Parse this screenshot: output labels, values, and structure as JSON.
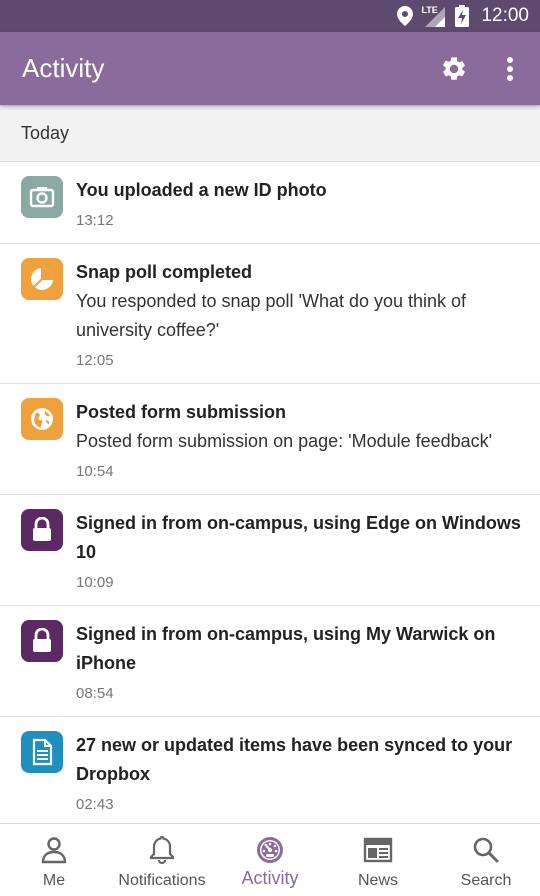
{
  "status_bar": {
    "network": "LTE",
    "time": "12:00"
  },
  "app_bar": {
    "title": "Activity"
  },
  "section": {
    "label": "Today"
  },
  "activities": [
    {
      "title": "You uploaded a new ID photo",
      "description": "",
      "time": "13:12",
      "icon": "camera-icon",
      "color": "#8aa9a3"
    },
    {
      "title": "Snap poll completed",
      "description": "You responded to snap poll 'What do you think of university coffee?'",
      "time": "12:05",
      "icon": "pie-chart-icon",
      "color": "#f0a03c"
    },
    {
      "title": "Posted form submission",
      "description": "Posted form submission on page: 'Module feedback'",
      "time": "10:54",
      "icon": "globe-icon",
      "color": "#f0a03c"
    },
    {
      "title": "Signed in from on-campus, using Edge on Windows 10",
      "description": "",
      "time": "10:09",
      "icon": "lock-icon",
      "color": "#5b2a63"
    },
    {
      "title": "Signed in from on-campus, using My Warwick on iPhone",
      "description": "",
      "time": "08:54",
      "icon": "lock-icon",
      "color": "#5b2a63"
    },
    {
      "title": "27 new or updated items have been synced to your Dropbox",
      "description": "",
      "time": "02:43",
      "icon": "document-icon",
      "color": "#1f8fc0"
    }
  ],
  "bottom_nav": {
    "me": "Me",
    "notifications": "Notifications",
    "activity": "Activity",
    "news": "News",
    "search": "Search"
  },
  "colors": {
    "app_bar": "#8b6a9c",
    "status_bar": "#5f4a6f",
    "active_tab": "#8b6a9c"
  }
}
